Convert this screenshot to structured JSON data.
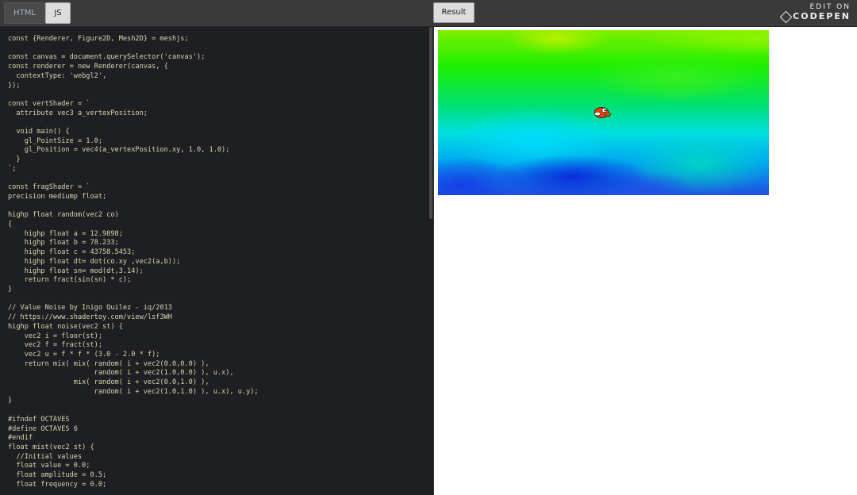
{
  "toolbar": {
    "tab_html": "HTML",
    "tab_js": "JS",
    "result_button": "Result",
    "edit_on": "EDIT ON",
    "brand": "CODEPEN"
  },
  "editor": {
    "code": "const {Renderer, Figure2D, Mesh2D} = meshjs;\n\nconst canvas = document.querySelector('canvas');\nconst renderer = new Renderer(canvas, {\n  contextType: 'webgl2',\n});\n\nconst vertShader = `\n  attribute vec3 a_vertexPosition;\n\n  void main() {\n    gl_PointSize = 1.0;\n    gl_Position = vec4(a_vertexPosition.xy, 1.0, 1.0);\n  }\n`;\n\nconst fragShader = `\nprecision mediump float;\n\nhighp float random(vec2 co)\n{\n    highp float a = 12.9898;\n    highp float b = 78.233;\n    highp float c = 43758.5453;\n    highp float dt= dot(co.xy ,vec2(a,b));\n    highp float sn= mod(dt,3.14);\n    return fract(sin(sn) * c);\n}\n\n// Value Noise by Inigo Quilez - iq/2013\n// https://www.shadertoy.com/view/lsf3WH\nhighp float noise(vec2 st) {\n    vec2 i = floor(st);\n    vec2 f = fract(st);\n    vec2 u = f * f * (3.0 - 2.0 * f);\n    return mix( mix( random( i + vec2(0.0,0.0) ),\n                     random( i + vec2(1.0,0.0) ), u.x),\n                mix( random( i + vec2(0.0,1.0) ),\n                     random( i + vec2(1.0,1.0) ), u.x), u.y);\n}\n\n#ifndef OCTAVES\n#define OCTAVES 6\n#endif\nfloat mist(vec2 st) {\n  //Initial values\n  float value = 0.0;\n  float amplitude = 0.5;\n  float frequency = 0.0;"
  },
  "result": {
    "sprite_icon": "flappy-bird-icon"
  }
}
